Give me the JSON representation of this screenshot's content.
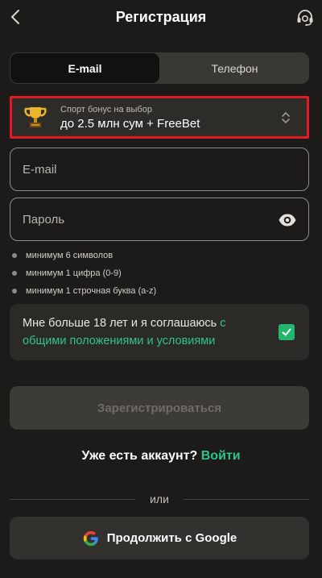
{
  "header": {
    "title": "Регистрация"
  },
  "tabs": [
    {
      "label": "E-mail",
      "active": true
    },
    {
      "label": "Телефон",
      "active": false
    }
  ],
  "bonus": {
    "caption": "Спорт бонус на выбор",
    "value": "до 2.5 млн сум + FreeBet"
  },
  "fields": {
    "email_placeholder": "E-mail",
    "password_placeholder": "Пароль"
  },
  "password_rules": [
    "минимум 6 символов",
    "минимум 1 цифра (0-9)",
    "минимум 1 строчная буква (a-z)"
  ],
  "consent": {
    "text": "Мне больше 18 лет и я соглашаюсь ",
    "link": "с общими положениями и условиями",
    "checked": true
  },
  "register_button": "Зарегистрироваться",
  "login": {
    "prompt": "Уже есть аккаунт? ",
    "link": "Войти"
  },
  "divider": "или",
  "google_button": "Продолжить с Google",
  "colors": {
    "accent": "#2ec58a",
    "background": "#1c1b19",
    "highlight_border": "#e01b24"
  },
  "icons": [
    "back-icon",
    "support-headset-icon",
    "trophy-icon",
    "chevron-updown-icon",
    "eye-icon",
    "check-icon",
    "google-icon"
  ]
}
